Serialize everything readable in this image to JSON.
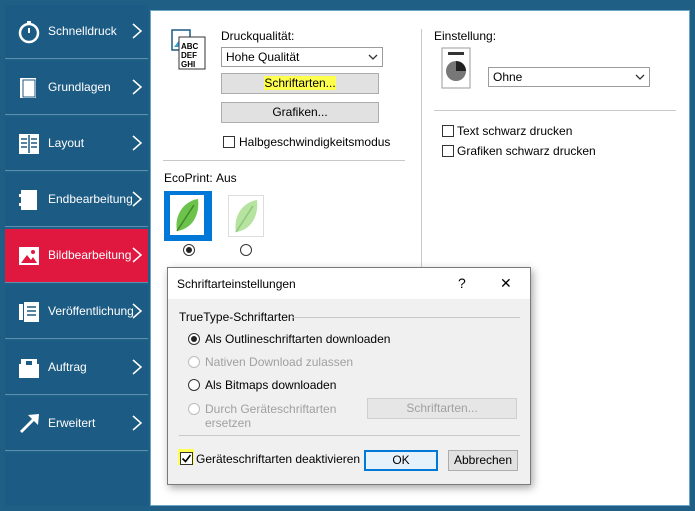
{
  "sidebar": {
    "items": [
      {
        "label": "Schnelldruck",
        "icon": "stopwatch-icon",
        "active": false
      },
      {
        "label": "Grundlagen",
        "icon": "page-icon",
        "active": false
      },
      {
        "label": "Layout",
        "icon": "layout-grid-icon",
        "active": false
      },
      {
        "label": "Endbearbeitung",
        "icon": "staple-finishing-icon",
        "active": false
      },
      {
        "label": "Bildbearbeitung",
        "icon": "image-edit-icon",
        "active": true
      },
      {
        "label": "Veröffentlichung",
        "icon": "publishing-icon",
        "active": false
      },
      {
        "label": "Auftrag",
        "icon": "job-box-icon",
        "active": false
      },
      {
        "label": "Erweitert",
        "icon": "arrow-advanced-icon",
        "active": false
      }
    ]
  },
  "print_quality": {
    "label": "Druckqualität:",
    "value": "Hohe Qualität",
    "fonts_button": "Schriftarten...",
    "graphics_button": "Grafiken...",
    "half_speed_label": "Halbgeschwindigkeitsmodus",
    "icon_text": "ABC DEF GHI"
  },
  "ecoprint": {
    "label": "EcoPrint:",
    "value": "Aus"
  },
  "setting": {
    "label": "Einstellung:",
    "value": "Ohne",
    "text_black_label": "Text schwarz drucken",
    "graphics_black_label": "Grafiken schwarz drucken"
  },
  "dialog": {
    "title": "Schriftarteinstellungen",
    "help": "?",
    "close": "✕",
    "group_label": "TrueType-Schriftarten",
    "options": [
      {
        "label": "Als Outlineschriftarten downloaden",
        "selected": true,
        "disabled": false
      },
      {
        "label": "Nativen Download zulassen",
        "selected": false,
        "disabled": true
      },
      {
        "label": "Als Bitmaps downloaden",
        "selected": false,
        "disabled": false
      },
      {
        "label": "Durch Geräteschriftarten ersetzen",
        "selected": false,
        "disabled": true
      }
    ],
    "fonts_button": "Schriftarten...",
    "disable_device_fonts_label": "Geräteschriftarten deaktivieren",
    "disable_device_fonts_checked": true,
    "ok": "OK",
    "cancel": "Abbrechen"
  },
  "colors": {
    "sidebar_bg": "#1c5b84",
    "active_bg": "#e0173f",
    "highlight": "#ffff4d",
    "selection_blue": "#0078d7"
  }
}
